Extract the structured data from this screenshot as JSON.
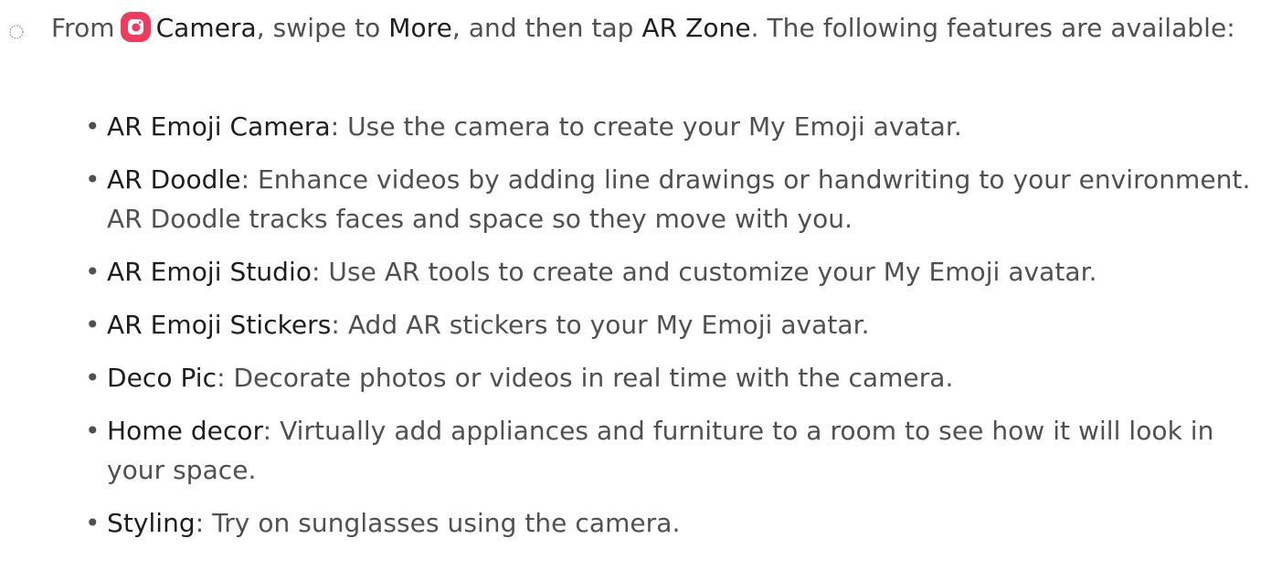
{
  "colors": {
    "camera_icon": "#f03a5f",
    "body_text": "#505050",
    "emphasis_text": "#1e1e1e"
  },
  "step": {
    "bullet_icon": "step-circle-icon",
    "from": "From",
    "camera_icon": "camera-app-icon",
    "camera": "Camera",
    "swipe_to": ", swipe to",
    "more": "More",
    "and_then_tap": ", and then tap",
    "ar_zone": "AR Zone",
    "following": ". The following features are available:"
  },
  "features": [
    {
      "name": "AR Emoji Camera",
      "description": ": Use the camera to create your My Emoji avatar."
    },
    {
      "name": "AR Doodle",
      "description": ": Enhance videos by adding line drawings or handwriting to your environment. AR Doodle tracks faces and space so they move with you."
    },
    {
      "name": "AR Emoji Studio",
      "description": ": Use AR tools to create and customize your My Emoji avatar."
    },
    {
      "name": "AR Emoji Stickers",
      "description": ": Add AR stickers to your My Emoji avatar."
    },
    {
      "name": "Deco Pic",
      "description": ": Decorate photos or videos in real time with the camera."
    },
    {
      "name": "Home decor",
      "description": ": Virtually add appliances and furniture to a room to see how it will look in your space."
    },
    {
      "name": "Styling",
      "description": ": Try on sunglasses using the camera."
    }
  ],
  "bullet": "•"
}
